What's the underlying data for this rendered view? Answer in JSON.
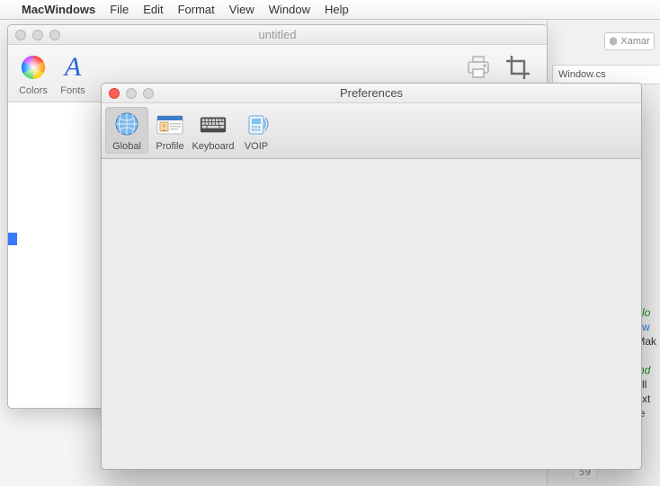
{
  "menubar": {
    "app_name": "MacWindows",
    "items": [
      "File",
      "Edit",
      "Format",
      "View",
      "Window",
      "Help"
    ]
  },
  "untitled_window": {
    "title": "untitled",
    "toolbar": {
      "colors_label": "Colors",
      "fonts_label": "Fonts",
      "print_label": "Print",
      "resize_label": "Resize"
    }
  },
  "preferences_window": {
    "title": "Preferences",
    "tabs": {
      "global": "Global",
      "profile": "Profile",
      "keyboard": "Keyboard",
      "voip": "VOIP"
    }
  },
  "ide": {
    "pill_label": "Xamar",
    "tab_label": "Window.cs",
    "code_lines": [
      "olo",
      "ew",
      "Mak",
      "",
      "ind",
      "oll",
      "ext",
      "te",
      ";"
    ],
    "line_number": "59"
  }
}
